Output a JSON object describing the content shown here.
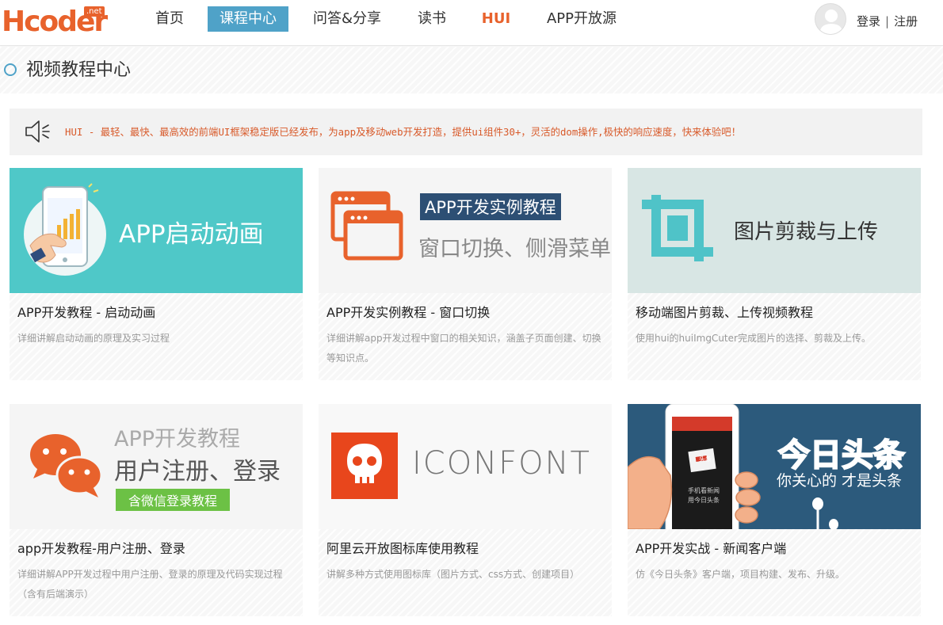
{
  "logo": {
    "text": "Hcoder",
    "badge": ".net"
  },
  "nav": {
    "items": [
      {
        "label": "首页"
      },
      {
        "label": "课程中心"
      },
      {
        "label": "问答&分享"
      },
      {
        "label": "读书"
      },
      {
        "label": "HUI"
      },
      {
        "label": "APP开放源"
      }
    ]
  },
  "auth": {
    "login": "登录",
    "separator": "|",
    "register": "注册"
  },
  "page": {
    "title": "视频教程中心"
  },
  "notice": {
    "icon": "speaker-icon",
    "text": "HUI - 最轻、最快、最高效的前端UI框架稳定版已经发布，为app及移动web开发打造，提供ui组件30+，灵活的dom操作,极快的响应速度，快来体验吧！"
  },
  "cards": [
    {
      "banner": {
        "line1": "APP启动动画"
      },
      "title": "APP开发教程 - 启动动画",
      "desc": "详细讲解启动动画的原理及实习过程",
      "bg": "#4fc8c8"
    },
    {
      "banner": {
        "line1": "APP开发实例教程",
        "line2": "窗口切换、侧滑菜单"
      },
      "title": "APP开发实例教程 - 窗口切换",
      "desc": "详细讲解app开发过程中窗口的相关知识，涵盖子页面创建、切换等知识点。",
      "bg": "#f5f5f5"
    },
    {
      "banner": {
        "line1": "图片剪裁与上传"
      },
      "title": "移动端图片剪裁、上传视频教程",
      "desc": "使用hui的huiImgCuter完成图片的选择、剪裁及上传。",
      "bg": "#d8e6e4"
    },
    {
      "banner": {
        "line1": "APP开发教程",
        "line2": "用户注册、登录",
        "tag": "含微信登录教程"
      },
      "title": "app开发教程-用户注册、登录",
      "desc": "详细讲解APP开发过程中用户注册、登录的原理及代码实现过程（含有后端演示）",
      "bg": "#f5f5f5"
    },
    {
      "banner": {
        "line1": "ICONFONT"
      },
      "title": "阿里云开放图标库使用教程",
      "desc": "讲解多种方式使用图标库（图片方式、css方式、创建项目）",
      "bg": "#f8f8f8"
    },
    {
      "banner": {
        "line1": "今日头条",
        "line2": "你关心的 才是头条",
        "phone1": "头条",
        "phone2": "手机看新闻",
        "phone3": "用今日头条"
      },
      "title": "APP开发实战 - 新闻客户端",
      "desc": "仿《今日头条》客户端，项目构建、发布、升级。",
      "bg": "#2c5a7c"
    }
  ],
  "colors": {
    "accent": "#4fa2c8",
    "brand": "#e8622c",
    "notice_text": "#d85a2a"
  }
}
